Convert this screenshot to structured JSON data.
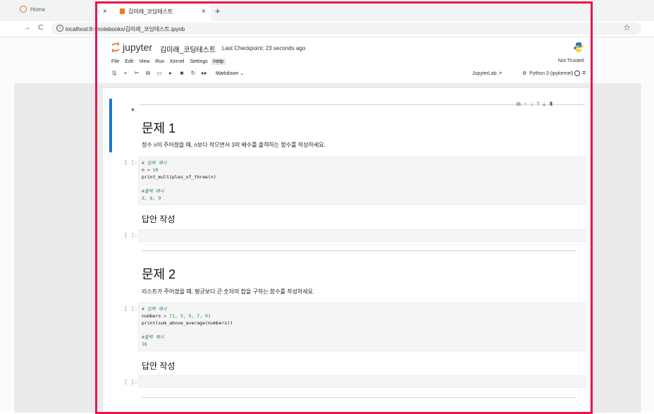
{
  "browser": {
    "inactive_tab_title": "Home",
    "active_tab_title": "김미래_코딩테스트",
    "tab_close": "×",
    "new_tab": "+",
    "url": "localhost:8888/notebooks/김미래_코딩테스트.ipynb",
    "url_visible": "localhost:8○/notebooks/김미래_코딩테스트.ipynb",
    "nav_forward": "→",
    "nav_reload": "C",
    "bookmark": "☆"
  },
  "jupyter": {
    "logo_text": "jupyter",
    "notebook_name": "김미래_코딩테스트",
    "checkpoint": "Last Checkpoint: 23 seconds ago",
    "menu": [
      "File",
      "Edit",
      "View",
      "Run",
      "Kernel",
      "Settings",
      "Help"
    ],
    "trust_status": "Not Trusted",
    "cell_type": "Markdown",
    "jupyterlab_link": "JupyterLab",
    "kernel_name": "Python 3 (ipykernel)"
  },
  "cells": {
    "p1_title": "문제 1",
    "p1_desc": "정수 n이 주어졌을 때, n보다 작으면서 3의 배수를 출력하는 함수를 작성하세요.",
    "p1_code": {
      "prompt": "[ ]:",
      "comment_input": "# 입력 예시",
      "line1_var": "n",
      "line1_op": "=",
      "line1_val": "10",
      "line2": "print_multiples_of_three(n)",
      "comment_output": "#출력 예시",
      "output": "3, 6, 9"
    },
    "p1_answer_heading": "답안 작성",
    "p1_answer_prompt": "[ ]:",
    "p2_title": "문제 2",
    "p2_desc": "리스트가 주어졌을 때, 평균보다 큰 숫자의 합을 구하는 함수를 작성하세요.",
    "p2_code": {
      "prompt": "[ ]:",
      "comment_input": "# 입력 예시",
      "line1_var": "numbers",
      "line1_op": "=",
      "line1_val": "[1, 3, 5, 7, 9]",
      "line2": "print(sum_above_average(numbers))",
      "comment_output": "#출력 예시",
      "output": "16"
    },
    "p2_answer_heading": "답안 작성",
    "p2_answer_prompt": "[ ]:"
  },
  "colors": {
    "frame": "#e5184a",
    "selection_bar": "#1976d2",
    "jupyter_orange": "#f37726"
  },
  "icons": [
    "save-icon",
    "add-cell-icon",
    "cut-icon",
    "copy-icon",
    "paste-icon",
    "run-icon",
    "stop-icon",
    "restart-icon",
    "fast-forward-icon",
    "external-link-icon",
    "kernel-gear-icon",
    "menu-icon",
    "python-logo-icon",
    "jupyter-logo-icon"
  ]
}
